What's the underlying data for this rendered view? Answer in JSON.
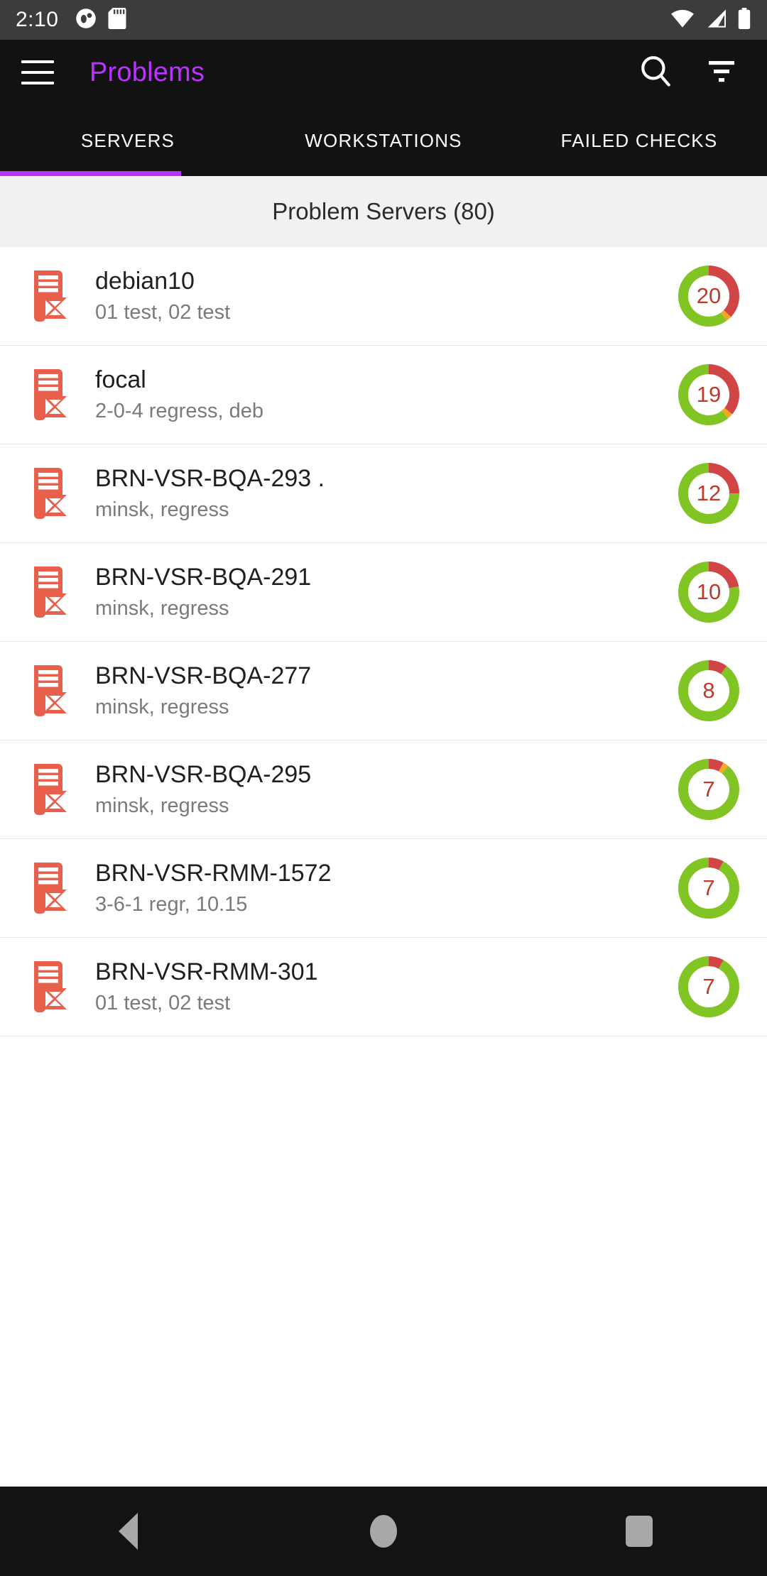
{
  "status_bar": {
    "time": "2:10",
    "icons": [
      "app-notification-icon",
      "sd-card-icon"
    ],
    "right_icons": [
      "wifi-icon",
      "cellular-signal-icon",
      "battery-icon"
    ],
    "background": "#3c3c3c"
  },
  "app_bar": {
    "menu_icon": "hamburger-menu-icon",
    "title": "Problems",
    "title_color": "#bb33ff",
    "search_icon": "search-icon",
    "filter_icon": "filter-icon",
    "background": "#121212"
  },
  "tabs": {
    "items": [
      {
        "label": "SERVERS",
        "selected": true
      },
      {
        "label": "WORKSTATIONS",
        "selected": false
      },
      {
        "label": "FAILED CHECKS",
        "selected": false
      }
    ],
    "indicator_color": "#bb33ff"
  },
  "section": {
    "title": "Problem Servers (80)",
    "background": "#f1f1f1"
  },
  "colors": {
    "accent": "#bb33ff",
    "server_icon": "#e8604c",
    "donut_red": "#d14545",
    "donut_green": "#81c524",
    "donut_orange": "#f5a623",
    "count_text": "#c0392b",
    "subtitle": "#7a7a7a"
  },
  "list": {
    "icon_name": "server-problem-icon",
    "rows": [
      {
        "title": "debian10",
        "subtitle": "01 test, 02 test",
        "count": "20",
        "red_pct": 37,
        "orange_pct": 3
      },
      {
        "title": "focal",
        "subtitle": "2-0-4 regress, deb",
        "count": "19",
        "red_pct": 36,
        "orange_pct": 3
      },
      {
        "title": "BRN-VSR-BQA-293 .",
        "subtitle": "minsk, regress",
        "count": "12",
        "red_pct": 25,
        "orange_pct": 0
      },
      {
        "title": "BRN-VSR-BQA-291",
        "subtitle": "minsk, regress",
        "count": "10",
        "red_pct": 22,
        "orange_pct": 0
      },
      {
        "title": "BRN-VSR-BQA-277",
        "subtitle": "minsk, regress",
        "count": "8",
        "red_pct": 10,
        "orange_pct": 0
      },
      {
        "title": "BRN-VSR-BQA-295",
        "subtitle": "minsk, regress",
        "count": "7",
        "red_pct": 8,
        "orange_pct": 3
      },
      {
        "title": "BRN-VSR-RMM-1572",
        "subtitle": "3-6-1 regr, 10.15",
        "count": "7",
        "red_pct": 8,
        "orange_pct": 0
      },
      {
        "title": "BRN-VSR-RMM-301",
        "subtitle": "01 test, 02 test",
        "count": "7",
        "red_pct": 8,
        "orange_pct": 0
      }
    ]
  },
  "nav_bar": {
    "back_icon": "back-triangle-icon",
    "home_icon": "home-circle-icon",
    "recents_icon": "recents-square-icon",
    "background": "#131313"
  }
}
